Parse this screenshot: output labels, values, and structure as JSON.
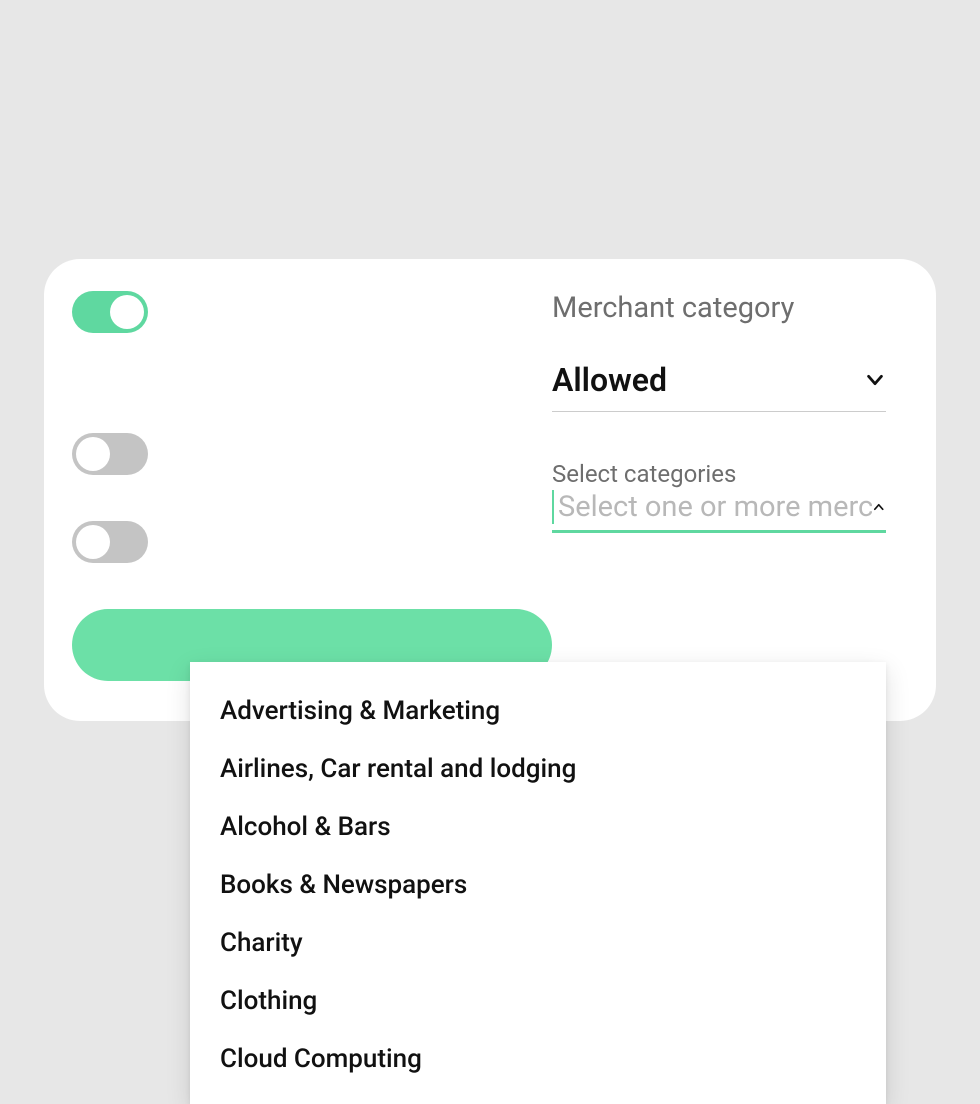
{
  "colors": {
    "accent": "#5FD8A0",
    "toggle_off": "#C4C4C4",
    "text_muted": "#6E6E6E"
  },
  "section": {
    "title": "Merchant category",
    "mode_select_value": "Allowed",
    "categories_field_label": "Select categories",
    "categories_placeholder": "Select one or more merchant categories"
  },
  "category_options": [
    "Advertising & Marketing",
    "Airlines, Car rental and lodging",
    "Alcohol & Bars",
    "Books & Newspapers",
    "Charity",
    "Clothing",
    "Cloud Computing"
  ],
  "toggles": {
    "merchant_category_on": true,
    "extra1_on": false,
    "extra2_on": false
  }
}
